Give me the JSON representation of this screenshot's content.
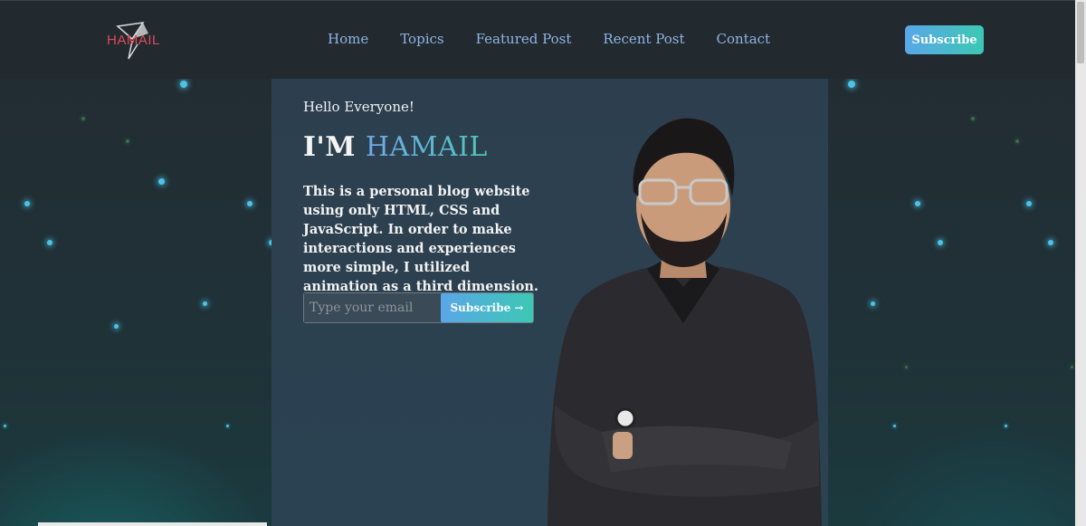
{
  "header": {
    "logo_text": "HAMAIL",
    "nav": [
      "Home",
      "Topics",
      "Featured Post",
      "Recent Post",
      "Contact"
    ],
    "subscribe_label": "Subscribe"
  },
  "hero": {
    "greeting": "Hello Everyone!",
    "title_prefix": "I'M ",
    "title_name": "HAMAIL",
    "description": "This is a personal blog website using only HTML, CSS and JavaScript. In order to make interactions and experiences more simple, I utilized animation as a third dimension.",
    "email_placeholder": "Type your email",
    "subscribe_label": "Subscribe →"
  },
  "colors": {
    "accent_start": "#5aa6e8",
    "accent_end": "#3cc8b4",
    "nav_link": "#8fb4e6",
    "logo_red": "#e04a5a"
  },
  "icons": {
    "logo_mark": "triangle-shard-icon",
    "arrow": "arrow-right-icon"
  }
}
